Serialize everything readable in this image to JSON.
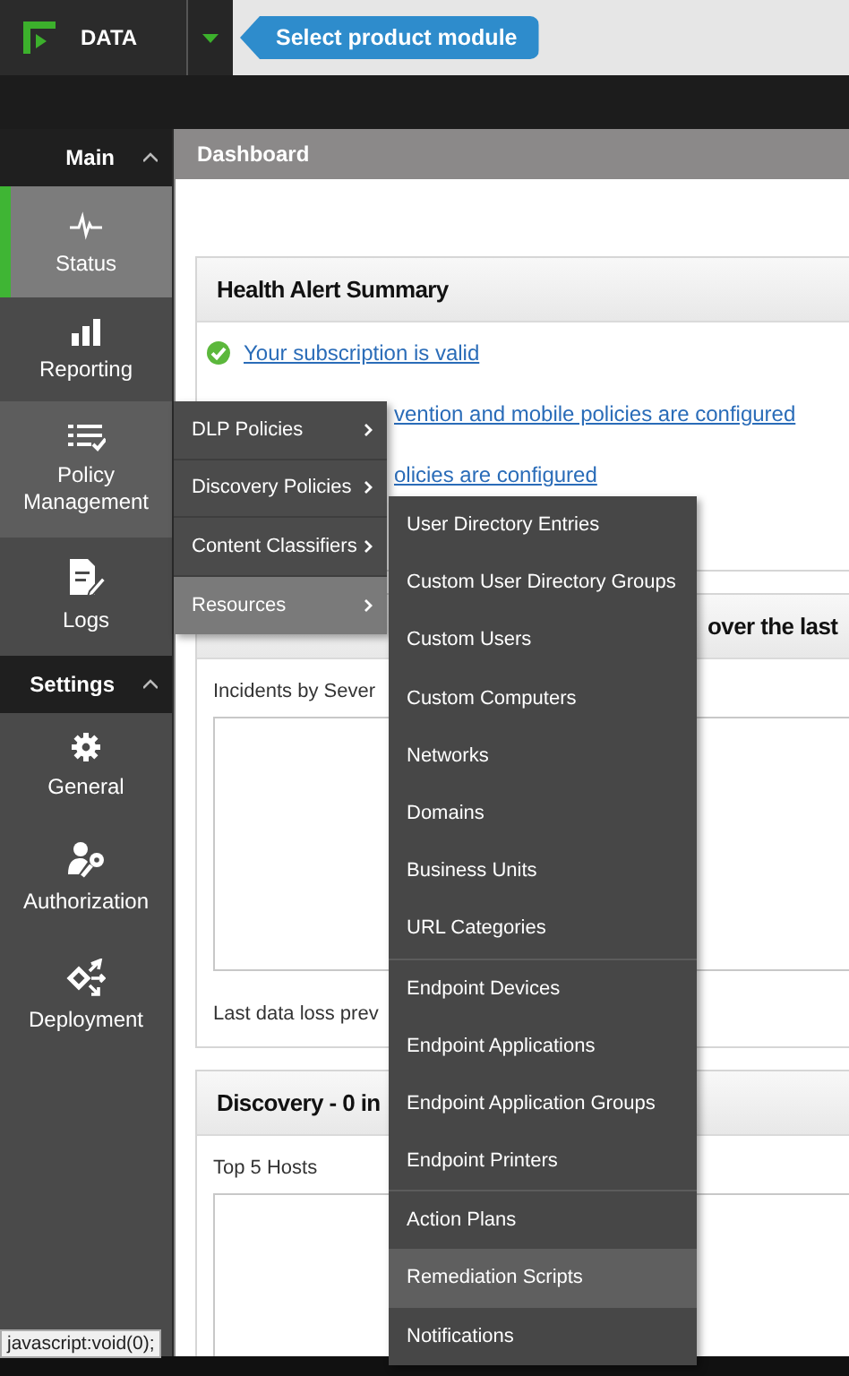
{
  "header": {
    "product": "DATA",
    "callout": "Select product module"
  },
  "sidebar": {
    "sections": [
      {
        "title": "Main",
        "expanded": true,
        "items": [
          {
            "label": "Status",
            "selected": true,
            "open": false
          },
          {
            "label": "Reporting",
            "selected": false,
            "open": false
          },
          {
            "label": "Policy Management",
            "selected": false,
            "open": true
          },
          {
            "label": "Logs",
            "selected": false,
            "open": false
          }
        ]
      },
      {
        "title": "Settings",
        "expanded": true,
        "items": [
          {
            "label": "General",
            "selected": false,
            "open": false
          },
          {
            "label": "Authorization",
            "selected": false,
            "open": false
          },
          {
            "label": "Deployment",
            "selected": false,
            "open": false
          }
        ]
      }
    ]
  },
  "breadcrumb": "Dashboard",
  "cards": [
    {
      "title": "Health Alert Summary",
      "title_partial": false,
      "alerts": [
        {
          "text": "Your subscription is valid",
          "kind": "full"
        },
        {
          "text": "vention and mobile policies are configured",
          "kind": "partial"
        },
        {
          "text": "olicies are configured",
          "kind": "partial"
        }
      ]
    },
    {
      "title": "over the last",
      "title_partial": true,
      "label": "Incidents by Sever",
      "footer": "Last data loss prev"
    },
    {
      "title": "Discovery - 0 in",
      "title_partial": false,
      "label": "Top 5 Hosts"
    }
  ],
  "menu": {
    "items": [
      {
        "label": "DLP Policies",
        "selected": false
      },
      {
        "label": "Discovery Policies",
        "selected": false
      },
      {
        "label": "Content Classifiers",
        "selected": false
      },
      {
        "label": "Resources",
        "selected": true
      }
    ]
  },
  "submenu": {
    "groups": [
      [
        {
          "label": "User Directory Entries",
          "selected": false
        },
        {
          "label": "Custom User Directory Groups",
          "selected": false
        },
        {
          "label": "Custom Users",
          "selected": false
        },
        {
          "label": "Custom Computers",
          "selected": false
        },
        {
          "label": "Networks",
          "selected": false
        },
        {
          "label": "Domains",
          "selected": false
        },
        {
          "label": "Business Units",
          "selected": false
        },
        {
          "label": "URL Categories",
          "selected": false
        }
      ],
      [
        {
          "label": "Endpoint Devices",
          "selected": false
        },
        {
          "label": "Endpoint Applications",
          "selected": false
        },
        {
          "label": "Endpoint Application Groups",
          "selected": false
        },
        {
          "label": "Endpoint Printers",
          "selected": false
        }
      ],
      [
        {
          "label": "Action Plans",
          "selected": false
        },
        {
          "label": "Remediation Scripts",
          "selected": true
        },
        {
          "label": "Notifications",
          "selected": false
        }
      ]
    ]
  },
  "status_bar": "javascript:void(0);"
}
